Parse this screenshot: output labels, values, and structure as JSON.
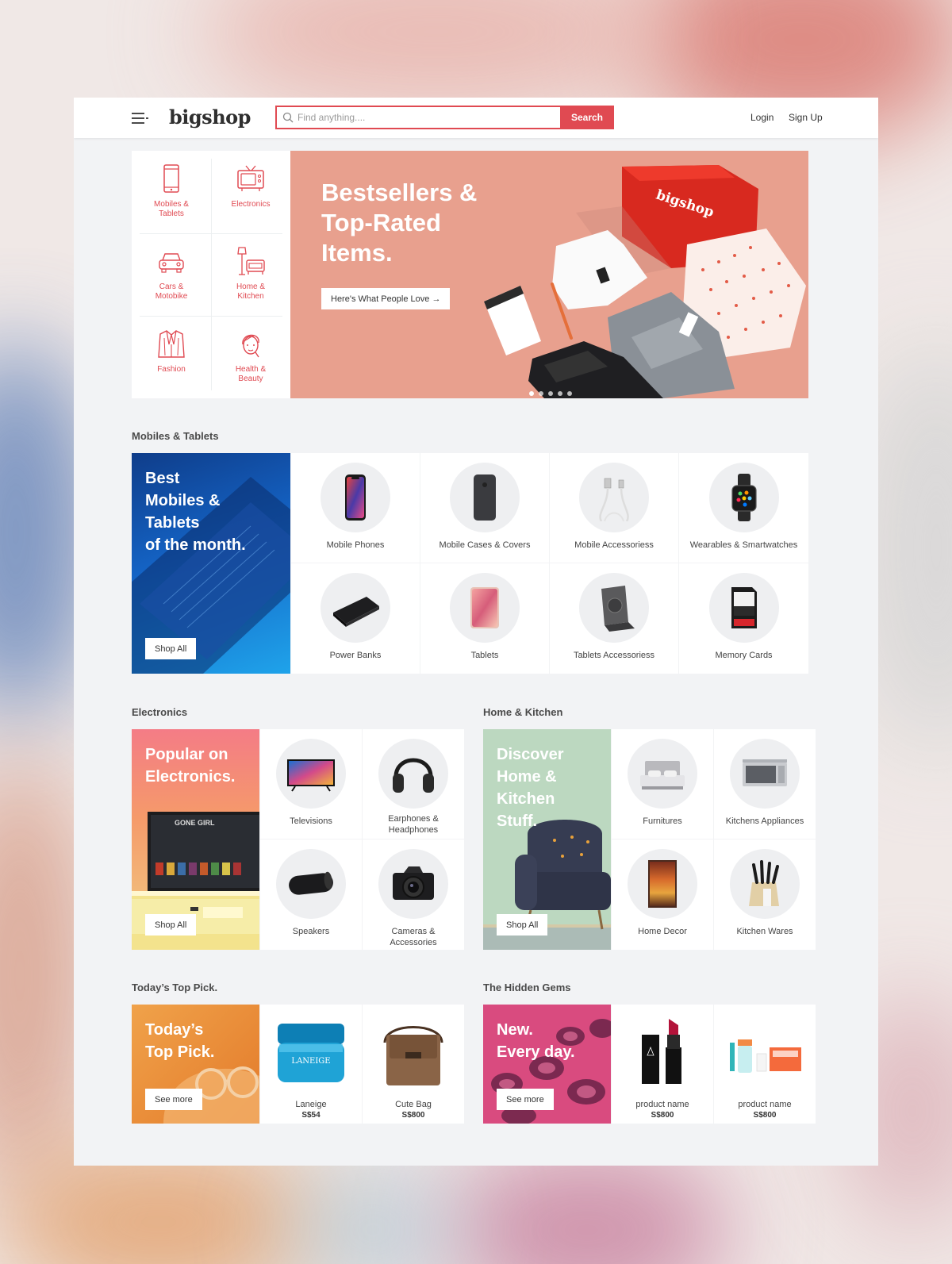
{
  "header": {
    "logo": "bigshop",
    "search_placeholder": "Find anything....",
    "search_button": "Search",
    "login": "Login",
    "signup": "Sign Up"
  },
  "categories": [
    {
      "label": "Mobiles &\nTablets",
      "icon": "mobile-icon"
    },
    {
      "label": "Electronics",
      "icon": "tv-icon"
    },
    {
      "label": "Cars &\nMotobike",
      "icon": "car-icon"
    },
    {
      "label": "Home &\nKitchen",
      "icon": "lamp-sofa-icon"
    },
    {
      "label": "Fashion",
      "icon": "jacket-icon"
    },
    {
      "label": "Health &\nBeauty",
      "icon": "face-icon"
    }
  ],
  "hero": {
    "title": "Bestsellers &\nTop-Rated\nItems.",
    "button": "Here's What People Love →",
    "box_text": "bigshop",
    "slide_count": 5,
    "active_slide": 1
  },
  "mobiles": {
    "title": "Mobiles & Tablets",
    "promo_title": "Best\nMobiles &\nTablets\nof the month.",
    "promo_button": "Shop All",
    "items": [
      {
        "label": "Mobile Phones",
        "icon": "smartphone-icon"
      },
      {
        "label": "Mobile Cases & Covers",
        "icon": "phone-case-icon"
      },
      {
        "label": "Mobile Accessoriess",
        "icon": "cable-icon"
      },
      {
        "label": "Wearables & Smartwatches",
        "icon": "smartwatch-icon"
      },
      {
        "label": "Power Banks",
        "icon": "power-bank-icon"
      },
      {
        "label": "Tablets",
        "icon": "tablet-icon"
      },
      {
        "label": "Tablets Accessoriess",
        "icon": "tablet-case-icon"
      },
      {
        "label": "Memory Cards",
        "icon": "sd-card-icon"
      }
    ]
  },
  "electronics": {
    "title": "Electronics",
    "promo_title": "Popular on\nElectronics.",
    "promo_button": "Shop All",
    "tv_text": "GONE GIRL",
    "items": [
      {
        "label": "Televisions",
        "icon": "television-icon"
      },
      {
        "label": "Earphones &\nHeadphones",
        "icon": "headphones-icon"
      },
      {
        "label": "Speakers",
        "icon": "speaker-icon"
      },
      {
        "label": "Cameras &\nAccessories",
        "icon": "camera-icon"
      }
    ]
  },
  "home_kitchen": {
    "title": "Home & Kitchen",
    "promo_title": "Discover\nHome &\nKitchen\nStuff.",
    "promo_button": "Shop All",
    "items": [
      {
        "label": "Furnitures",
        "icon": "bed-icon"
      },
      {
        "label": "Kitchens Appliances",
        "icon": "microwave-icon"
      },
      {
        "label": "Home Decor",
        "icon": "painting-icon"
      },
      {
        "label": "Kitchen Wares",
        "icon": "knife-block-icon"
      }
    ]
  },
  "top_pick": {
    "title": "Today’s Top Pick.",
    "promo_title": "Today’s\nTop Pick.",
    "promo_button": "See more",
    "items": [
      {
        "label": "Laneige",
        "price": "S$54",
        "icon": "cream-jar-icon",
        "brand_text": "LANEIGE"
      },
      {
        "label": "Cute Bag",
        "price": "S$800",
        "icon": "bag-icon"
      }
    ]
  },
  "hidden_gems": {
    "title": "The Hidden Gems",
    "promo_title": "New.\nEvery day.",
    "promo_button": "See more",
    "items": [
      {
        "label": "product name",
        "price": "S$800",
        "icon": "lipstick-icon"
      },
      {
        "label": "product name",
        "price": "S$800",
        "icon": "cosmetics-set-icon"
      }
    ]
  },
  "colors": {
    "accent": "#e04a52",
    "hero_bg": "#e8a08e",
    "mobiles_promo": "#1a7fd9",
    "electronics_promo": "#f28a72",
    "home_promo": "#bcd8c0",
    "top_pick_promo": "#e9883a",
    "hidden_gems_promo": "#d94b7f"
  }
}
